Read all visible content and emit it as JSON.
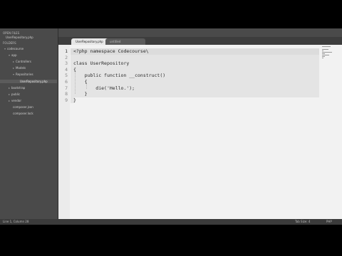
{
  "sidebar": {
    "open_files_header": "OPEN FILES",
    "open_file": "UserRepository.php",
    "folders_header": "FOLDERS",
    "items": [
      {
        "label": "codecourse",
        "depth": 0
      },
      {
        "label": "app",
        "depth": 1
      },
      {
        "label": "Controllers",
        "depth": 2
      },
      {
        "label": "Models",
        "depth": 2
      },
      {
        "label": "Repositories",
        "depth": 2
      },
      {
        "label": "UserRepository.php",
        "depth": 3,
        "selected": true
      },
      {
        "label": "bootstrap",
        "depth": 1
      },
      {
        "label": "public",
        "depth": 1
      },
      {
        "label": "vendor",
        "depth": 1
      },
      {
        "label": "composer.json",
        "depth": 1
      },
      {
        "label": "composer.lock",
        "depth": 1
      }
    ]
  },
  "tabs": {
    "active_label": "UserRepository.php",
    "inactive_label": "untitled",
    "close_glyph": "×"
  },
  "editor": {
    "line_numbers": [
      "1",
      "2",
      "3",
      "4",
      "5",
      "6",
      "7",
      "8",
      "9"
    ],
    "lines": [
      "<?php namespace Codecourse\\",
      "",
      "class UserRepository",
      "{",
      "    public function __construct()",
      "    {",
      "        die('Hello.');",
      "    }",
      "}"
    ]
  },
  "status": {
    "position": "Line 1, Column 28",
    "tab_size": "Tab Size: 4",
    "syntax": "PHP"
  }
}
